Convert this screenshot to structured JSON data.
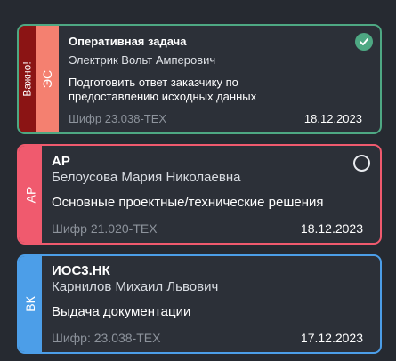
{
  "colors": {
    "background": "#262a31",
    "card_background": "#2c3038",
    "green": "#4ea883",
    "dark_red": "#8b1414",
    "salmon": "#f48070",
    "red": "#f05a6e",
    "blue": "#4c9ee8"
  },
  "tasks": [
    {
      "important_label": "Важно!",
      "section": "ЭС",
      "title": "Оперативная задача",
      "person": "Электрик Вольт Амперович",
      "description": "Подготовить ответ заказчику по предоставлению исходных данных",
      "code": "Шифр 23.038-ТЕХ",
      "date": "18.12.2023",
      "status_icon": "check-circle-icon",
      "completed": true
    },
    {
      "section": "АР",
      "title": "АР",
      "person": "Белоусова Мария Николаевна",
      "description": "Основные проектные/технические решения",
      "code": "Шифр 21.020-ТЕХ",
      "date": "18.12.2023",
      "status_icon": "empty-circle-icon",
      "completed": false
    },
    {
      "section": "ВК",
      "title": "ИОС3.НК",
      "person": "Карнилов Михаил Львович",
      "description": "Выдача документации",
      "code": "Шифр: 23.038-ТЕХ",
      "date": "17.12.2023"
    }
  ]
}
